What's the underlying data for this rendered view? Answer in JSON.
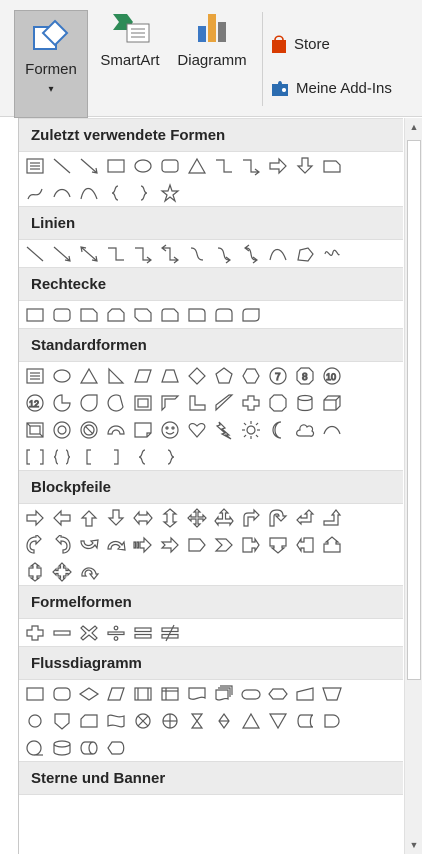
{
  "ribbon": {
    "formen_label": "Formen",
    "smartart_label": "SmartArt",
    "diagramm_label": "Diagramm",
    "store_label": "Store",
    "addins_label": "Meine Add-Ins",
    "caret": "▾"
  },
  "sections": [
    {
      "title": "Zuletzt verwendete Formen",
      "rows": [
        [
          "textbox",
          "line",
          "arrow-line",
          "rect",
          "oval",
          "rounded-rect",
          "triangle",
          "elbow",
          "elbow-arrow",
          "right-arrow",
          "down-arrow",
          "snip"
        ],
        [
          "freeform",
          "arc",
          "curve",
          "brace-left",
          "brace-right",
          "star"
        ]
      ]
    },
    {
      "title": "Linien",
      "rows": [
        [
          "line",
          "arrow-line",
          "double-line",
          "elbow",
          "elbow-arrow",
          "elbow-double",
          "curve-conn",
          "curve-arrow",
          "curve-double",
          "curve",
          "freeform-shape",
          "scribble"
        ]
      ]
    },
    {
      "title": "Rechtecke",
      "rows": [
        [
          "rect",
          "rounded-rect",
          "snip1",
          "snip2",
          "snip-diag",
          "round-snip",
          "round-one",
          "round-same",
          "round-diag"
        ]
      ]
    },
    {
      "title": "Standardformen",
      "rows": [
        [
          "textbox",
          "oval",
          "triangle",
          "right-triangle",
          "parallelogram",
          "trapezoid",
          "diamond",
          "pentagon",
          "hexagon",
          "n7",
          "n8",
          "n10"
        ],
        [
          "n12",
          "pie",
          "teardrop",
          "chord",
          "frame",
          "half-frame",
          "l-shape",
          "diag-stripe",
          "cross",
          "octagon",
          "can",
          "cube"
        ],
        [
          "bevel",
          "donut",
          "no-symbol",
          "block-arc",
          "folded",
          "smiley",
          "heart",
          "lightning",
          "sun",
          "moon",
          "cloud",
          "arc"
        ],
        [
          "bracket-pair",
          "brace-pair",
          "bracket-left",
          "bracket-right",
          "brace-left",
          "brace-right"
        ]
      ]
    },
    {
      "title": "Blockpfeile",
      "rows": [
        [
          "right-arrow",
          "left-arrow",
          "up-arrow",
          "down-arrow",
          "lr-arrow",
          "ud-arrow",
          "quad-arrow",
          "lru-arrow",
          "bent-arrow",
          "u-turn",
          "left-up",
          "bent-up"
        ],
        [
          "curved-right",
          "curved-left",
          "curved-up",
          "curved-down",
          "striped",
          "notched",
          "pentagon-arrow",
          "chevron",
          "callout-right",
          "callout-down",
          "callout-left",
          "callout-up"
        ],
        [
          "callout-ud",
          "callout-quad",
          "circular"
        ]
      ]
    },
    {
      "title": "Formelformen",
      "rows": [
        [
          "plus",
          "minus",
          "multiply",
          "divide",
          "equal",
          "not-equal"
        ]
      ]
    },
    {
      "title": "Flussdiagramm",
      "rows": [
        [
          "process",
          "alt-process",
          "decision",
          "data",
          "predefined",
          "internal",
          "document",
          "multidoc",
          "terminator",
          "preparation",
          "manual-input",
          "manual-op"
        ],
        [
          "connector",
          "offpage",
          "card",
          "punched-tape",
          "summing",
          "or",
          "collate",
          "sort",
          "extract",
          "merge",
          "stored-data",
          "delay"
        ],
        [
          "seq-access",
          "magnetic-disk",
          "direct-access",
          "display"
        ]
      ]
    },
    {
      "title": "Sterne und Banner",
      "rows": []
    }
  ],
  "scrollbar": {
    "up": "▲",
    "down": "▼"
  }
}
